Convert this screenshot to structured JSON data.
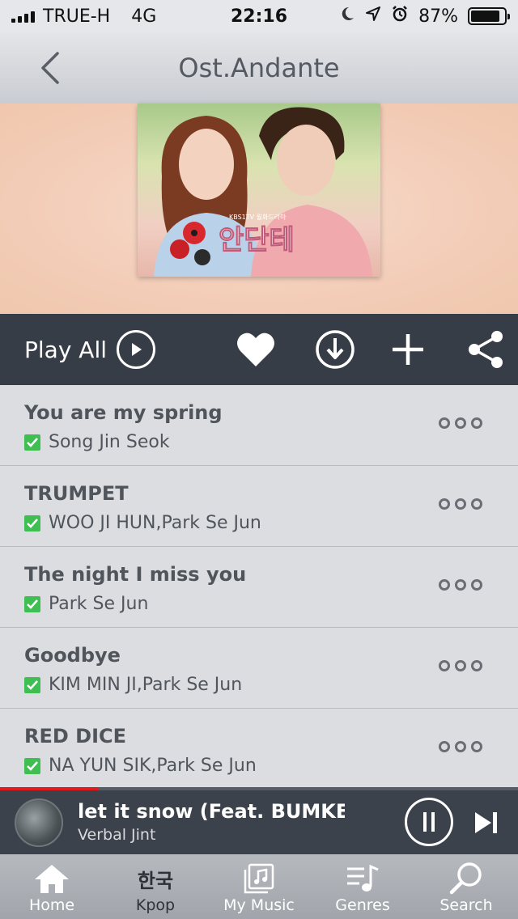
{
  "status_bar": {
    "carrier": "TRUE-H",
    "network": "4G",
    "time": "22:16",
    "battery": "87%",
    "battery_level": 0.87
  },
  "header": {
    "title": "Ost.Andante"
  },
  "hero": {
    "cover_text": "안단테",
    "cover_subtext": "KBS1TV 월화드라마"
  },
  "actions": {
    "play_all_label": "Play All"
  },
  "tracks": [
    {
      "title": "You are my spring",
      "artist": "Song Jin Seok"
    },
    {
      "title": "TRUMPET",
      "artist": "WOO JI HUN,Park Se Jun"
    },
    {
      "title": "The night I miss you",
      "artist": "Park Se Jun"
    },
    {
      "title": "Goodbye",
      "artist": "KIM MIN JI,Park Se Jun"
    },
    {
      "title": "RED DICE",
      "artist": "NA YUN SIK,Park Se Jun"
    }
  ],
  "now_playing": {
    "title": "let it snow (Feat. BUMKEY",
    "artist": "Verbal Jint",
    "progress": 0.19
  },
  "tabs": [
    {
      "label": "Home"
    },
    {
      "label": "Kpop",
      "icon_text": "한국"
    },
    {
      "label": "My Music"
    },
    {
      "label": "Genres"
    },
    {
      "label": "Search"
    }
  ],
  "colors": {
    "action_bar": "#363d47",
    "check_green": "#3fbf52",
    "progress_red": "#e2191d"
  }
}
